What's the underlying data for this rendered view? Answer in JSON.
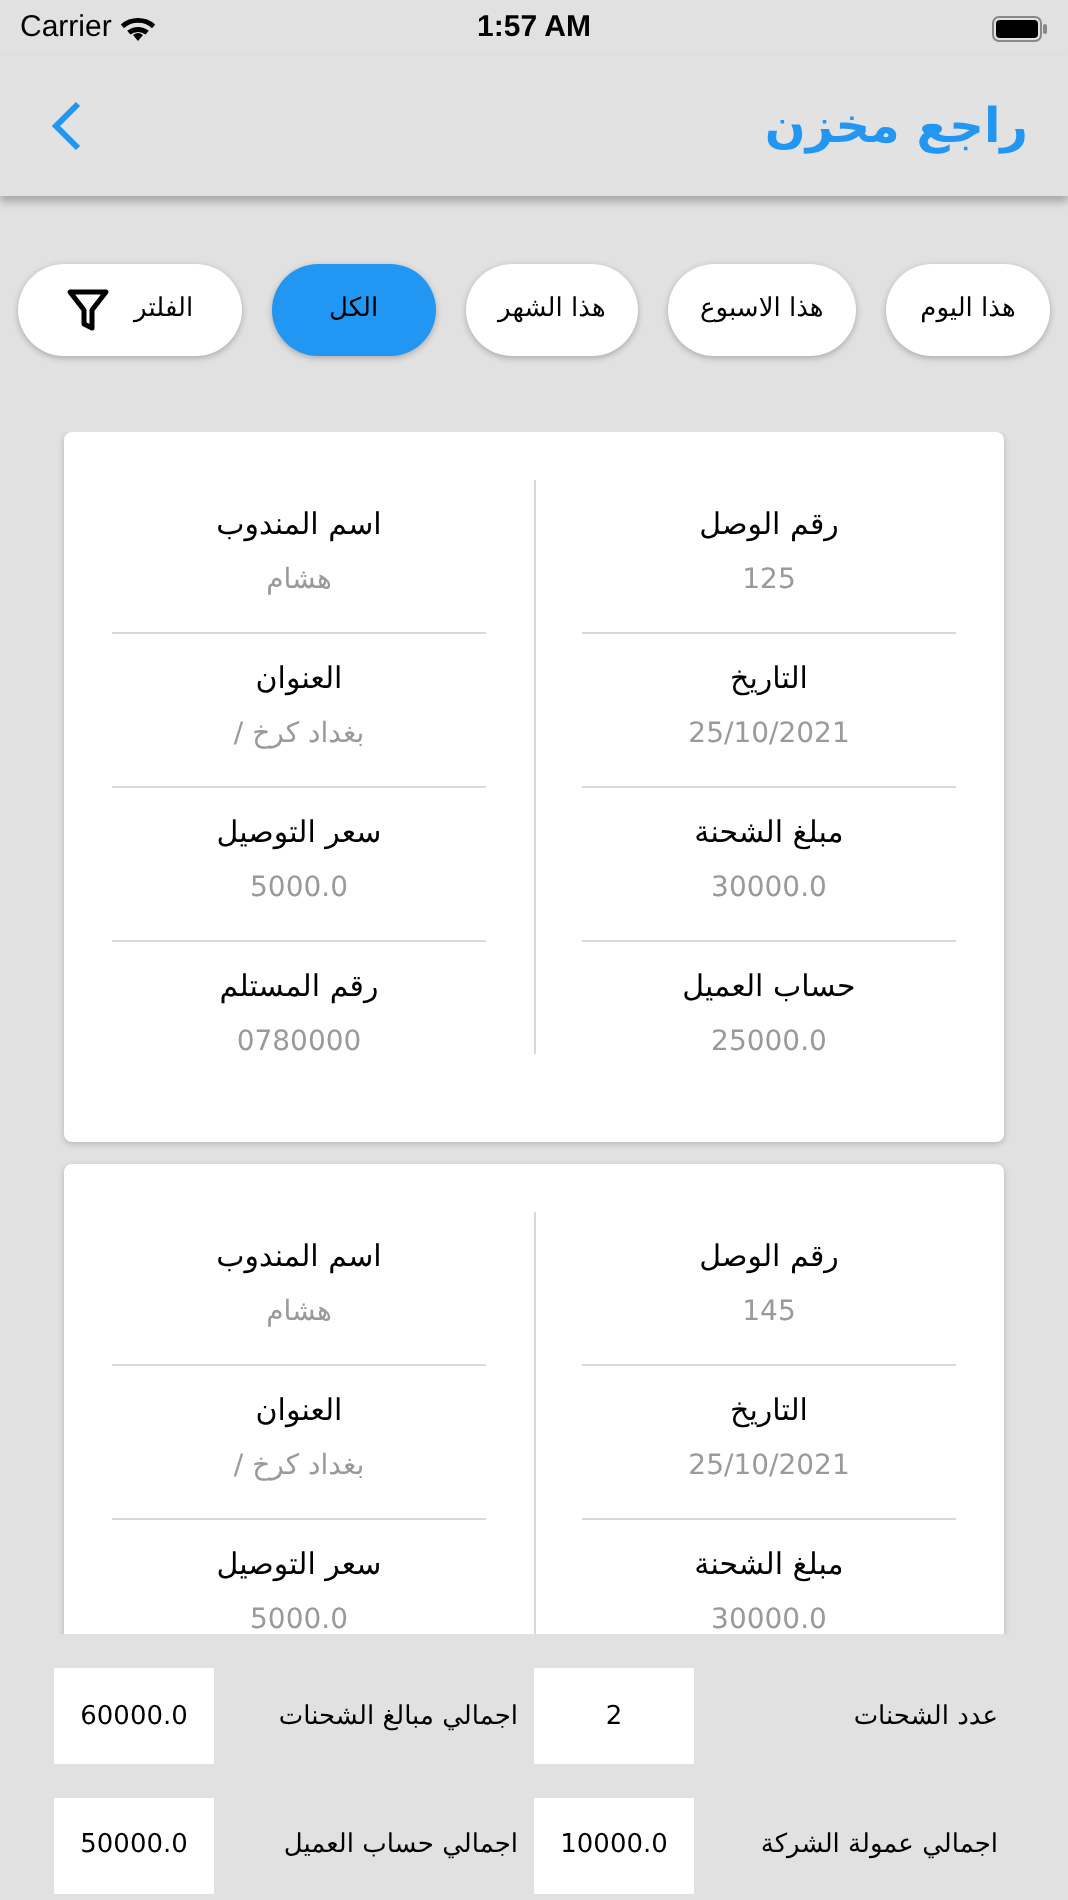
{
  "status_bar": {
    "carrier": "Carrier",
    "time": "1:57 AM"
  },
  "header": {
    "title": "راجع مخزن"
  },
  "filters": [
    {
      "label": "هذا اليوم",
      "kind": "period",
      "selected": false
    },
    {
      "label": "هذا الاسبوع",
      "kind": "period",
      "selected": false
    },
    {
      "label": "هذا الشهر",
      "kind": "period",
      "selected": false
    },
    {
      "label": "الكل",
      "kind": "period",
      "selected": true
    },
    {
      "label": "الفلتر",
      "kind": "filter",
      "selected": false
    }
  ],
  "cards": [
    {
      "cut_off": false,
      "rows": [
        [
          {
            "label": "رقم الوصل",
            "value": "125"
          },
          {
            "label": "اسم المندوب",
            "value": "هشام"
          }
        ],
        [
          {
            "label": "التاريخ",
            "value": "25/10/2021"
          },
          {
            "label": "العنوان",
            "value": "بغداد كرخ /"
          }
        ],
        [
          {
            "label": "مبلغ الشحنة",
            "value": "30000.0"
          },
          {
            "label": "سعر التوصيل",
            "value": "5000.0"
          }
        ],
        [
          {
            "label": "حساب العميل",
            "value": "25000.0"
          },
          {
            "label": "رقم المستلم",
            "value": "0780000"
          }
        ]
      ]
    },
    {
      "cut_off": true,
      "rows": [
        [
          {
            "label": "رقم الوصل",
            "value": "145"
          },
          {
            "label": "اسم المندوب",
            "value": "هشام"
          }
        ],
        [
          {
            "label": "التاريخ",
            "value": "25/10/2021"
          },
          {
            "label": "العنوان",
            "value": "بغداد كرخ /"
          }
        ],
        [
          {
            "label": "مبلغ الشحنة",
            "value": "30000.0"
          },
          {
            "label": "سعر التوصيل",
            "value": "5000.0"
          }
        ]
      ]
    }
  ],
  "totals": [
    {
      "label": "عدد الشحنات",
      "value": "2"
    },
    {
      "label": "اجمالي مبالغ الشحنات",
      "value": "60000.0"
    },
    {
      "label": "اجمالي عمولة الشركة",
      "value": "10000.0"
    },
    {
      "label": "اجمالي حساب العميل",
      "value": "50000.0"
    }
  ]
}
